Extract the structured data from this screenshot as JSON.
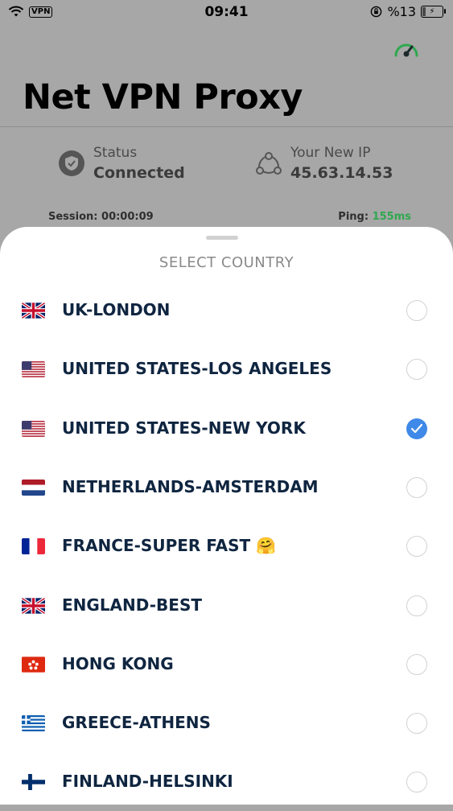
{
  "status_bar": {
    "vpn": "VPN",
    "time": "09:41",
    "battery": "%13"
  },
  "app": {
    "title": "Net VPN Proxy"
  },
  "stats": {
    "status_label": "Status",
    "status_value": "Connected",
    "ip_label": "Your New IP",
    "ip_value": "45.63.14.53",
    "session": "Session: 00:00:09",
    "ping_label": "Ping: ",
    "ping_value": "155ms"
  },
  "sheet": {
    "title": "SELECT COUNTRY",
    "countries": [
      {
        "label": "UK-LONDON",
        "flag": "uk-flag-icon",
        "selected": false
      },
      {
        "label": "UNITED STATES-LOS ANGELES",
        "flag": "us-flag-icon",
        "selected": false
      },
      {
        "label": "UNITED STATES-NEW YORK",
        "flag": "us-flag-icon",
        "selected": true
      },
      {
        "label": "NETHERLANDS-AMSTERDAM",
        "flag": "netherlands-flag-icon",
        "selected": false
      },
      {
        "label": "FRANCE-SUPER FAST 🤗",
        "flag": "france-flag-icon",
        "selected": false
      },
      {
        "label": "ENGLAND-BEST",
        "flag": "uk-flag-icon",
        "selected": false
      },
      {
        "label": "HONG KONG",
        "flag": "hong-kong-flag-icon",
        "selected": false
      },
      {
        "label": "GREECE-ATHENS",
        "flag": "greece-flag-icon",
        "selected": false
      },
      {
        "label": "FINLAND-HELSINKI",
        "flag": "finland-flag-icon",
        "selected": false
      }
    ]
  },
  "colors": {
    "accent": "#3f89e8",
    "ping_green": "#2fa84f",
    "label_navy": "#0f2540"
  }
}
